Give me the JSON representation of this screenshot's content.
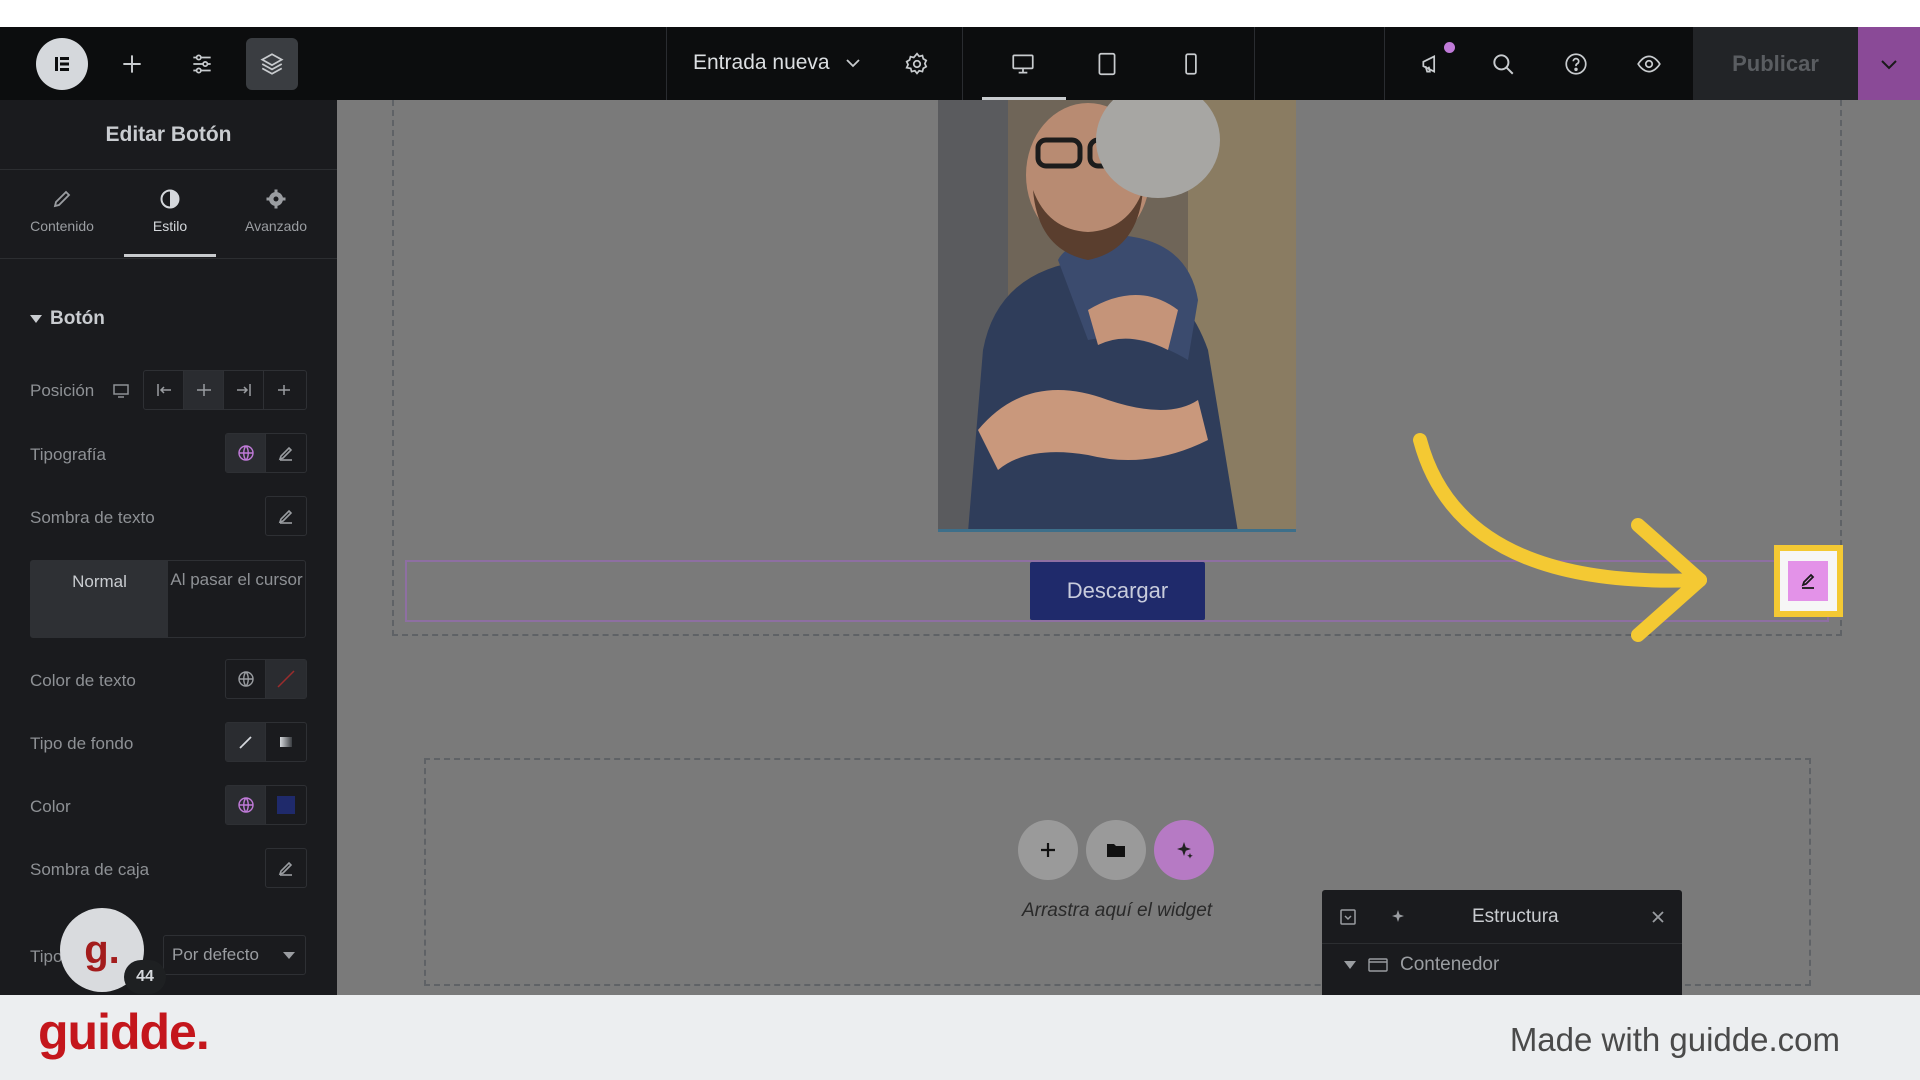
{
  "topbar": {
    "document_title": "Entrada nueva",
    "publish_label": "Publicar"
  },
  "panel": {
    "title": "Editar Botón",
    "tabs": [
      {
        "label": "Contenido"
      },
      {
        "label": "Estilo"
      },
      {
        "label": "Avanzado"
      }
    ],
    "active_tab": "Estilo",
    "section": "Botón",
    "rows": {
      "position": "Posición",
      "typography": "Tipografía",
      "text_shadow": "Sombra de texto",
      "text_color": "Color de texto",
      "bg_type": "Tipo de fondo",
      "color": "Color",
      "box_shadow": "Sombra de caja",
      "type_partial": "Tipo"
    },
    "state_tabs": {
      "normal": "Normal",
      "hover": "Al pasar el cursor"
    },
    "select_value": "Por defecto",
    "avatar_letter": "g.",
    "avatar_badge": "44"
  },
  "canvas": {
    "button_label": "Descargar",
    "drop_text": "Arrastra aquí el widget"
  },
  "structure": {
    "title": "Estructura",
    "item": "Contenedor"
  },
  "footer": {
    "brand": "guidde.",
    "made_with": "Made with guidde.com"
  },
  "colors": {
    "button_bg": "#1f2a6b",
    "highlight": "#f4c933",
    "accent_purple": "#8a4a97",
    "edit_pink": "#e392e8"
  }
}
